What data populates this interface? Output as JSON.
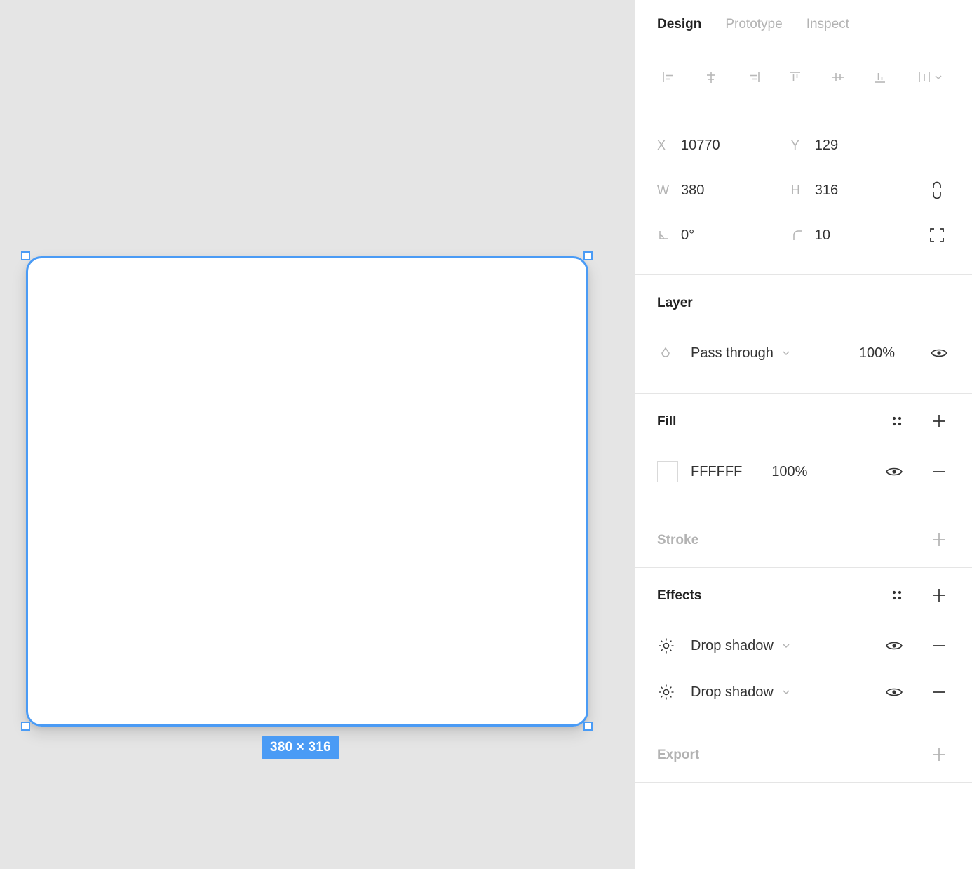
{
  "canvas": {
    "background_color": "#E5E5E5",
    "selection_color": "#4A9BF5",
    "shape": {
      "fill": "#FFFFFF",
      "corner_radius": 10
    },
    "size_badge": "380 × 316"
  },
  "panel": {
    "tabs": [
      {
        "label": "Design",
        "active": true
      },
      {
        "label": "Prototype",
        "active": false
      },
      {
        "label": "Inspect",
        "active": false
      }
    ],
    "align_tools": [
      {
        "name": "align-left"
      },
      {
        "name": "align-horizontal-center"
      },
      {
        "name": "align-right"
      },
      {
        "name": "align-top"
      },
      {
        "name": "align-vertical-center"
      },
      {
        "name": "align-bottom"
      },
      {
        "name": "distribute"
      }
    ],
    "properties": {
      "x": {
        "label": "X",
        "value": "10770"
      },
      "y": {
        "label": "Y",
        "value": "129"
      },
      "w": {
        "label": "W",
        "value": "380"
      },
      "h": {
        "label": "H",
        "value": "316"
      },
      "rotation": {
        "label": "rotation",
        "value": "0°"
      },
      "corner_radius": {
        "label": "corner-radius",
        "value": "10"
      }
    },
    "layer": {
      "title": "Layer",
      "blend_mode": "Pass through",
      "opacity": "100%"
    },
    "fill": {
      "title": "Fill",
      "items": [
        {
          "color": "FFFFFF",
          "opacity": "100%"
        }
      ]
    },
    "stroke": {
      "title": "Stroke",
      "empty": true
    },
    "effects": {
      "title": "Effects",
      "items": [
        {
          "label": "Drop shadow"
        },
        {
          "label": "Drop shadow"
        }
      ]
    },
    "export": {
      "title": "Export",
      "empty": true
    }
  }
}
